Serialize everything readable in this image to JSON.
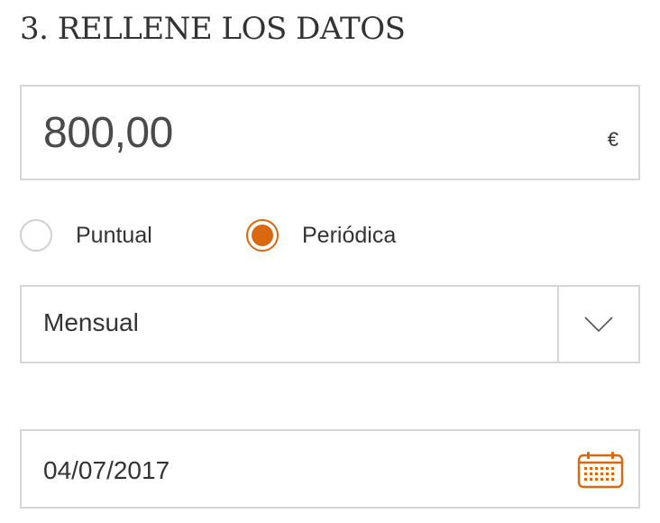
{
  "section": {
    "title": "3. RELLENE LOS DATOS"
  },
  "amount": {
    "value": "800,00",
    "currency": "€"
  },
  "periodicity": {
    "options": [
      {
        "label": "Puntual",
        "selected": false
      },
      {
        "label": "Periódica",
        "selected": true
      }
    ]
  },
  "frequency": {
    "selected": "Mensual",
    "arrow_icon": "chevron-down-icon"
  },
  "date": {
    "value": "04/07/2017",
    "icon": "calendar-icon"
  },
  "colors": {
    "accent": "#d9680f",
    "border": "#d6d6d6",
    "text": "#333333"
  }
}
